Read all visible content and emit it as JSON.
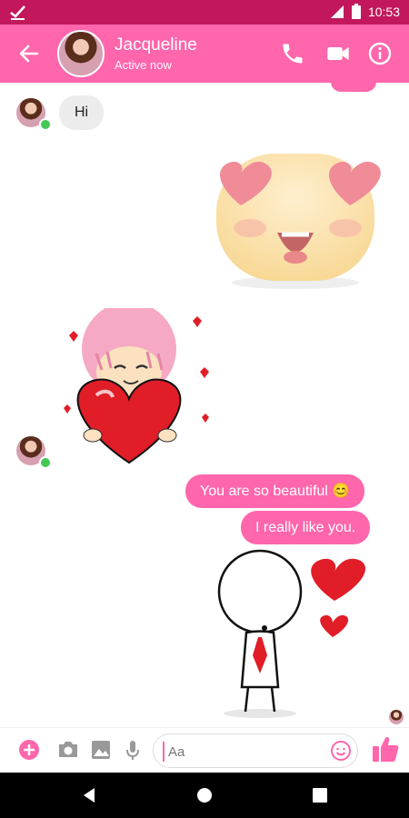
{
  "status_bar": {
    "time": "10:53"
  },
  "header": {
    "name": "Jacqueline",
    "status": "Active now"
  },
  "messages": {
    "hi": "Hi",
    "beautiful": "You are so beautiful 😊",
    "like": "I really like you."
  },
  "composer": {
    "placeholder": "Aa"
  },
  "colors": {
    "accent": "#ff66ac",
    "status_bar": "#c2185b",
    "incoming_bubble": "#ececec"
  }
}
